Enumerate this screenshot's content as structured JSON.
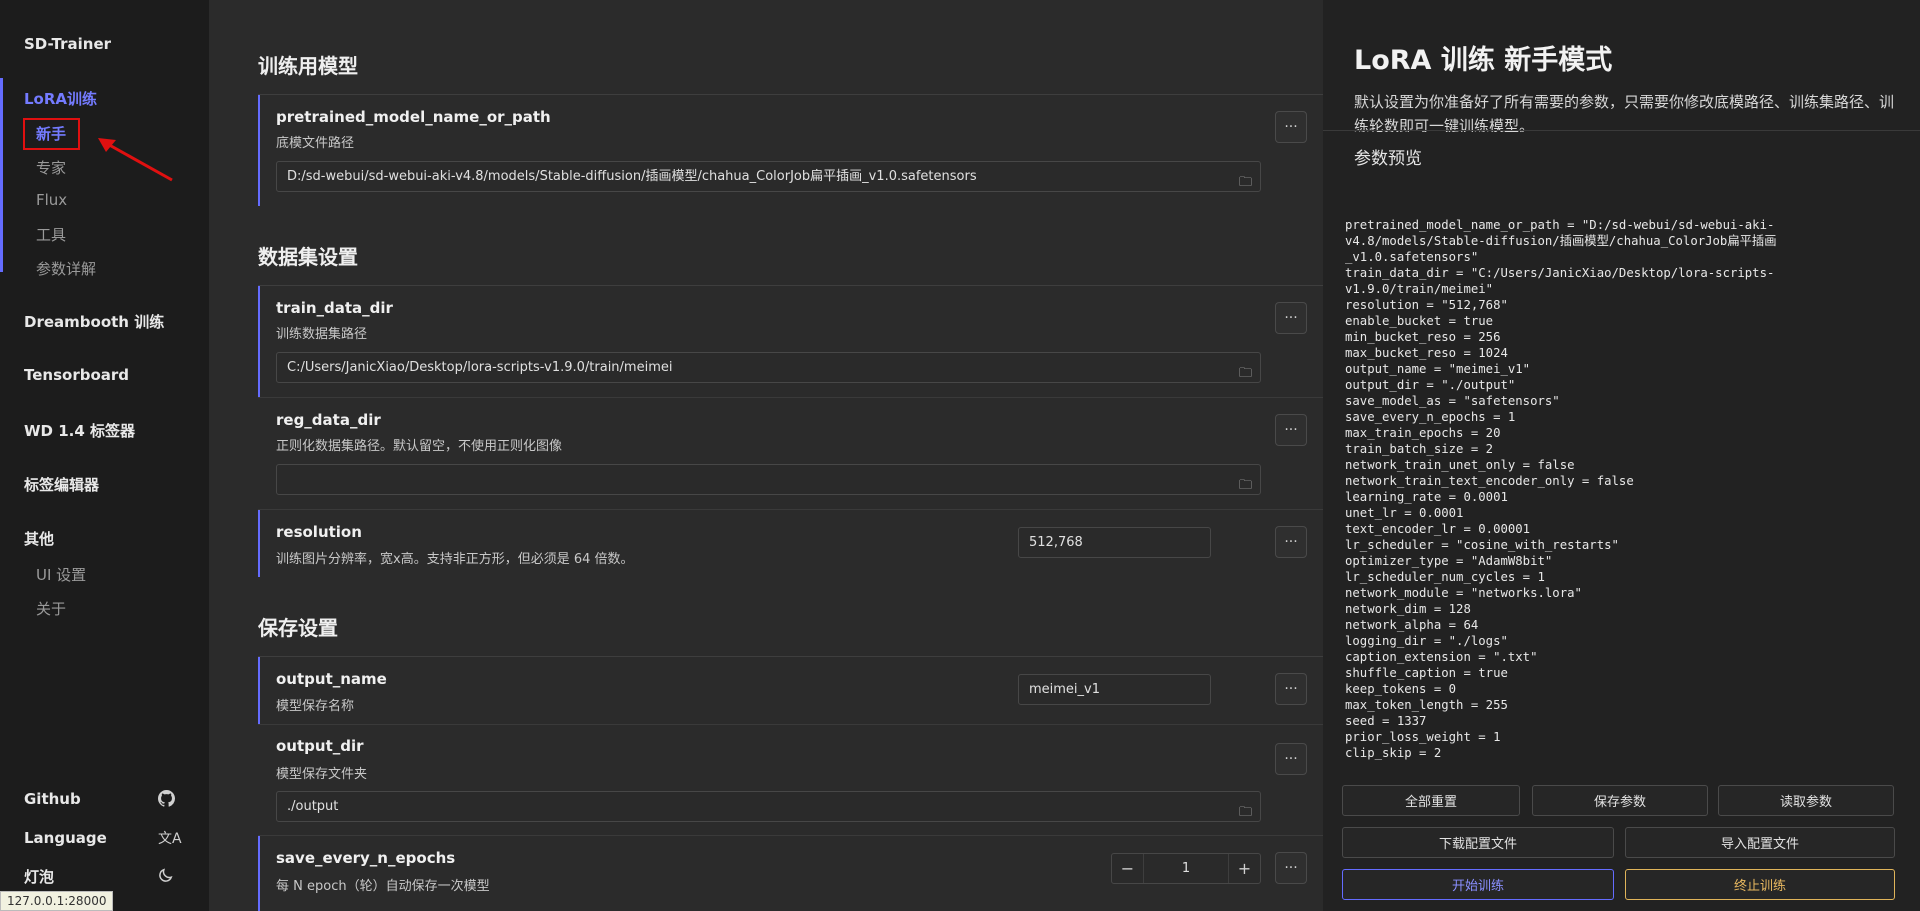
{
  "sidebar": {
    "brand": "SD-Trainer",
    "lora_group": "LoRA训练",
    "lora_items": [
      "新手",
      "专家",
      "Flux",
      "工具",
      "参数详解"
    ],
    "dreambooth": "Dreambooth 训练",
    "tensorboard": "Tensorboard",
    "wd_tagger": "WD 1.4 标签器",
    "tag_editor": "标签编辑器",
    "other_group": "其他",
    "other_items": [
      "UI 设置",
      "关于"
    ],
    "github": "Github",
    "language": "Language",
    "theme": "灯泡",
    "status_url": "127.0.0.1:28000"
  },
  "main": {
    "sections": {
      "model": "训练用模型",
      "dataset": "数据集设置",
      "save": "保存设置"
    },
    "fields": {
      "pretrained": {
        "name": "pretrained_model_name_or_path",
        "desc": "底模文件路径",
        "value": "D:/sd-webui/sd-webui-aki-v4.8/models/Stable-diffusion/插画模型/chahua_ColorJob扁平插画_v1.0.safetensors"
      },
      "train_data_dir": {
        "name": "train_data_dir",
        "desc": "训练数据集路径",
        "value": "C:/Users/JanicXiao/Desktop/lora-scripts-v1.9.0/train/meimei"
      },
      "reg_data_dir": {
        "name": "reg_data_dir",
        "desc": "正则化数据集路径。默认留空，不使用正则化图像",
        "value": ""
      },
      "resolution": {
        "name": "resolution",
        "desc": "训练图片分辨率，宽x高。支持非正方形，但必须是 64 倍数。",
        "value": "512,768"
      },
      "output_name": {
        "name": "output_name",
        "desc": "模型保存名称",
        "value": "meimei_v1"
      },
      "output_dir": {
        "name": "output_dir",
        "desc": "模型保存文件夹",
        "value": "./output"
      },
      "save_every": {
        "name": "save_every_n_epochs",
        "desc": "每 N epoch（轮）自动保存一次模型",
        "value": "1"
      }
    },
    "more_label": "···",
    "minus": "−",
    "plus": "+"
  },
  "right": {
    "title": "LoRA 训练 新手模式",
    "intro": "默认设置为你准备好了所有需要的参数，只需要你修改底模路径、训练集路径、训练轮数即可一键训练模型。",
    "preview_title": "参数预览",
    "config": "pretrained_model_name_or_path = \"D:/sd-webui/sd-webui-aki-\nv4.8/models/Stable-diffusion/插画模型/chahua_ColorJob扁平插画\n_v1.0.safetensors\"\ntrain_data_dir = \"C:/Users/JanicXiao/Desktop/lora-scripts-\nv1.9.0/train/meimei\"\nresolution = \"512,768\"\nenable_bucket = true\nmin_bucket_reso = 256\nmax_bucket_reso = 1024\noutput_name = \"meimei_v1\"\noutput_dir = \"./output\"\nsave_model_as = \"safetensors\"\nsave_every_n_epochs = 1\nmax_train_epochs = 20\ntrain_batch_size = 2\nnetwork_train_unet_only = false\nnetwork_train_text_encoder_only = false\nlearning_rate = 0.0001\nunet_lr = 0.0001\ntext_encoder_lr = 0.00001\nlr_scheduler = \"cosine_with_restarts\"\noptimizer_type = \"AdamW8bit\"\nlr_scheduler_num_cycles = 1\nnetwork_module = \"networks.lora\"\nnetwork_dim = 128\nnetwork_alpha = 64\nlogging_dir = \"./logs\"\ncaption_extension = \".txt\"\nshuffle_caption = true\nkeep_tokens = 0\nmax_token_length = 255\nseed = 1337\nprior_loss_weight = 1\nclip_skip = 2",
    "buttons": {
      "reset": "全部重置",
      "save": "保存参数",
      "load": "读取参数",
      "download": "下载配置文件",
      "import": "导入配置文件",
      "start": "开始训练",
      "stop": "终止训练"
    },
    "accent": "#646cff",
    "warn": "#e0b45a"
  }
}
